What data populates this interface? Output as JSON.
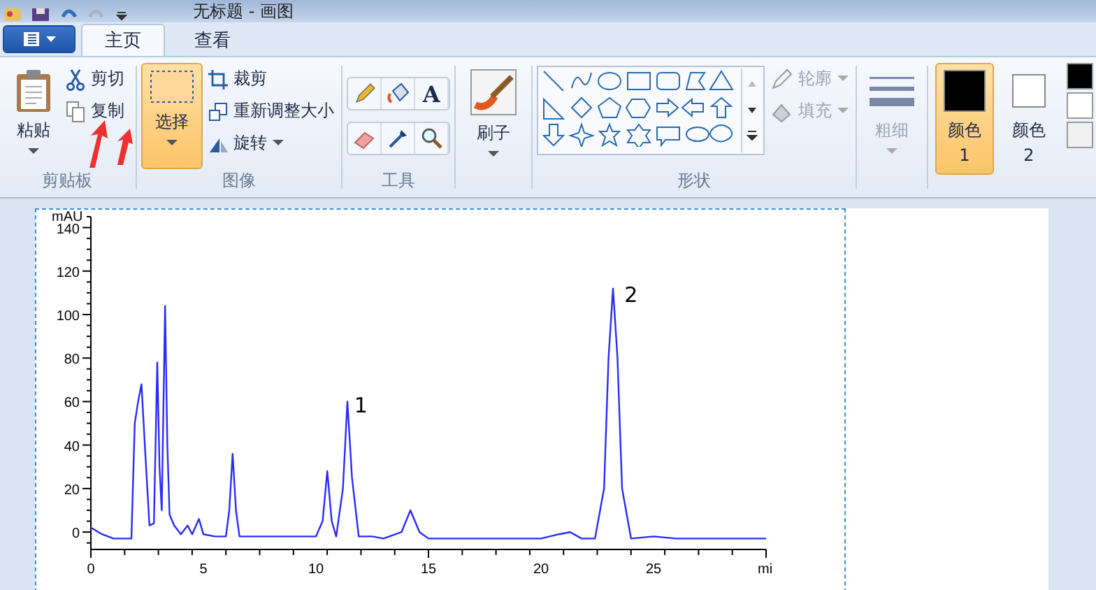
{
  "window": {
    "title": "无标题 - 画图"
  },
  "tabs": [
    {
      "label": "主页",
      "selected": true
    },
    {
      "label": "查看",
      "selected": false
    }
  ],
  "ribbon": {
    "groups": [
      {
        "kind": "clipboard",
        "label": "剪贴板",
        "paste": "粘贴",
        "cut": "剪切",
        "copy": "复制"
      },
      {
        "kind": "image",
        "label": "图像",
        "select": {
          "label": "选择",
          "selected": true
        },
        "crop": "裁剪",
        "resize": "重新调整大小",
        "rotate": "旋转"
      },
      {
        "kind": "tools",
        "label": "工具",
        "text_glyph": "A"
      },
      {
        "kind": "brushes",
        "label": "刷子"
      },
      {
        "kind": "shapes",
        "label": "形状",
        "outline": {
          "label": "轮廓",
          "disabled": true
        },
        "fill": {
          "label": "填充",
          "disabled": true
        }
      },
      {
        "kind": "size",
        "label": "粗细",
        "disabled": true
      },
      {
        "kind": "colors",
        "color1": {
          "label": "颜色 1",
          "color": "#000000",
          "selected": true
        },
        "color2": {
          "label": "颜色 2",
          "color": "#ffffff",
          "selected": false
        },
        "palette": [
          {
            "color": "#000000"
          },
          {
            "color": "#ffffff"
          },
          {
            "color": "#f0f0f0"
          }
        ]
      }
    ]
  },
  "canvas": {
    "chart_data": {
      "type": "line",
      "xlabel": "mi",
      "ylabel": "mAU",
      "xlim": [
        0,
        30
      ],
      "ylim": [
        -8,
        145
      ],
      "xticks": [
        0,
        5,
        10,
        15,
        20,
        25
      ],
      "yticks": [
        0,
        20,
        40,
        60,
        80,
        100,
        120,
        140
      ],
      "x": [
        0,
        0.5,
        1,
        1.5,
        1.8,
        1.95,
        2.1,
        2.25,
        2.4,
        2.6,
        2.8,
        2.95,
        3.05,
        3.15,
        3.3,
        3.4,
        3.5,
        3.7,
        4,
        4.3,
        4.5,
        4.8,
        5,
        5.5,
        6,
        6.15,
        6.3,
        6.45,
        6.6,
        7,
        8,
        9,
        10,
        10.3,
        10.5,
        10.7,
        10.9,
        11.2,
        11.4,
        11.6,
        11.9,
        12.5,
        13,
        13.8,
        14.2,
        14.6,
        15,
        16,
        18,
        20,
        20.8,
        21.3,
        21.8,
        22.4,
        22.8,
        23,
        23.2,
        23.4,
        23.6,
        24,
        25,
        26,
        28,
        30
      ],
      "series": [
        {
          "color": "#2a2aff",
          "values": [
            2,
            -1,
            -3,
            -3,
            -3,
            50,
            60,
            68,
            40,
            3,
            4,
            78,
            30,
            10,
            104,
            40,
            8,
            3,
            -1,
            3,
            -1,
            6,
            -1,
            -2,
            -2,
            10,
            36,
            10,
            -2,
            -2,
            -2,
            -2,
            -2,
            5,
            28,
            5,
            -2,
            20,
            60,
            25,
            -2,
            -2,
            -3,
            0,
            10,
            0,
            -3,
            -3,
            -3,
            -3,
            -1,
            0,
            -3,
            -3,
            20,
            80,
            112,
            80,
            20,
            -3,
            -2,
            -3,
            -3,
            -3
          ]
        }
      ],
      "annotations": [
        "1",
        "2"
      ]
    }
  }
}
